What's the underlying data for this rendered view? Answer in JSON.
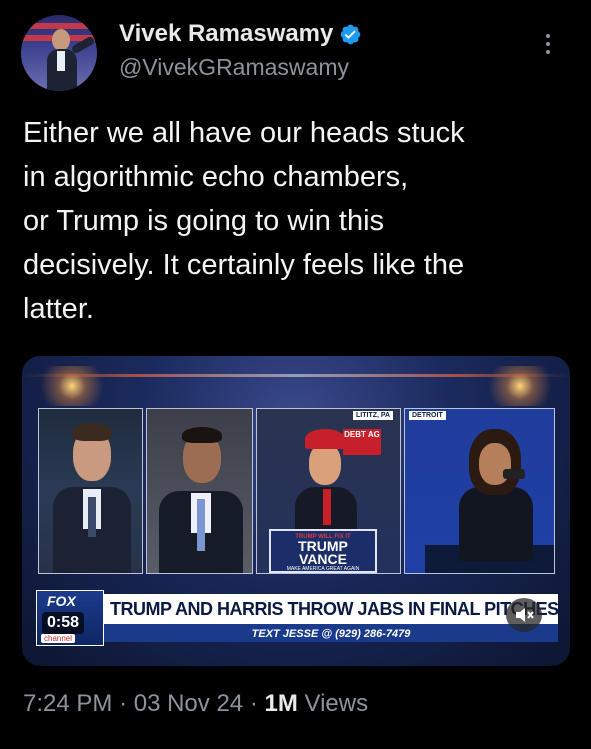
{
  "author": {
    "display_name": "Vivek Ramaswamy",
    "handle": "@VivekGRamaswamy",
    "verified_icon": "verified-badge-icon",
    "verified_color": "#1d9bf0"
  },
  "tweet": {
    "text": "Either we all have our heads stuck\nin algorithmic echo chambers,\nor Trump is going to win this\ndecisively. It certainly feels like the\nlatter."
  },
  "media": {
    "video_time": "0:58",
    "headline": "TRUMP AND HARRIS THROW JABS IN FINAL PITCHES",
    "ticker": "TEXT JESSE @ (929) 286-7479",
    "network": "FOX",
    "network_sub": "channel",
    "location_1": "LITITZ, PA",
    "location_2": "DETROIT",
    "sign_line_1": "TRUMP WILL FIX IT",
    "sign_line_2": "TRUMP",
    "sign_line_3": "VANCE",
    "sign_line_4": "MAKE AMERICA GREAT AGAIN",
    "banner_text": "DEBT AG",
    "mute_icon": "speaker-muted-icon"
  },
  "meta": {
    "time": "7:24 PM",
    "date": "03 Nov 24",
    "views_count": "1M",
    "views_label": "Views",
    "separator": "·"
  }
}
